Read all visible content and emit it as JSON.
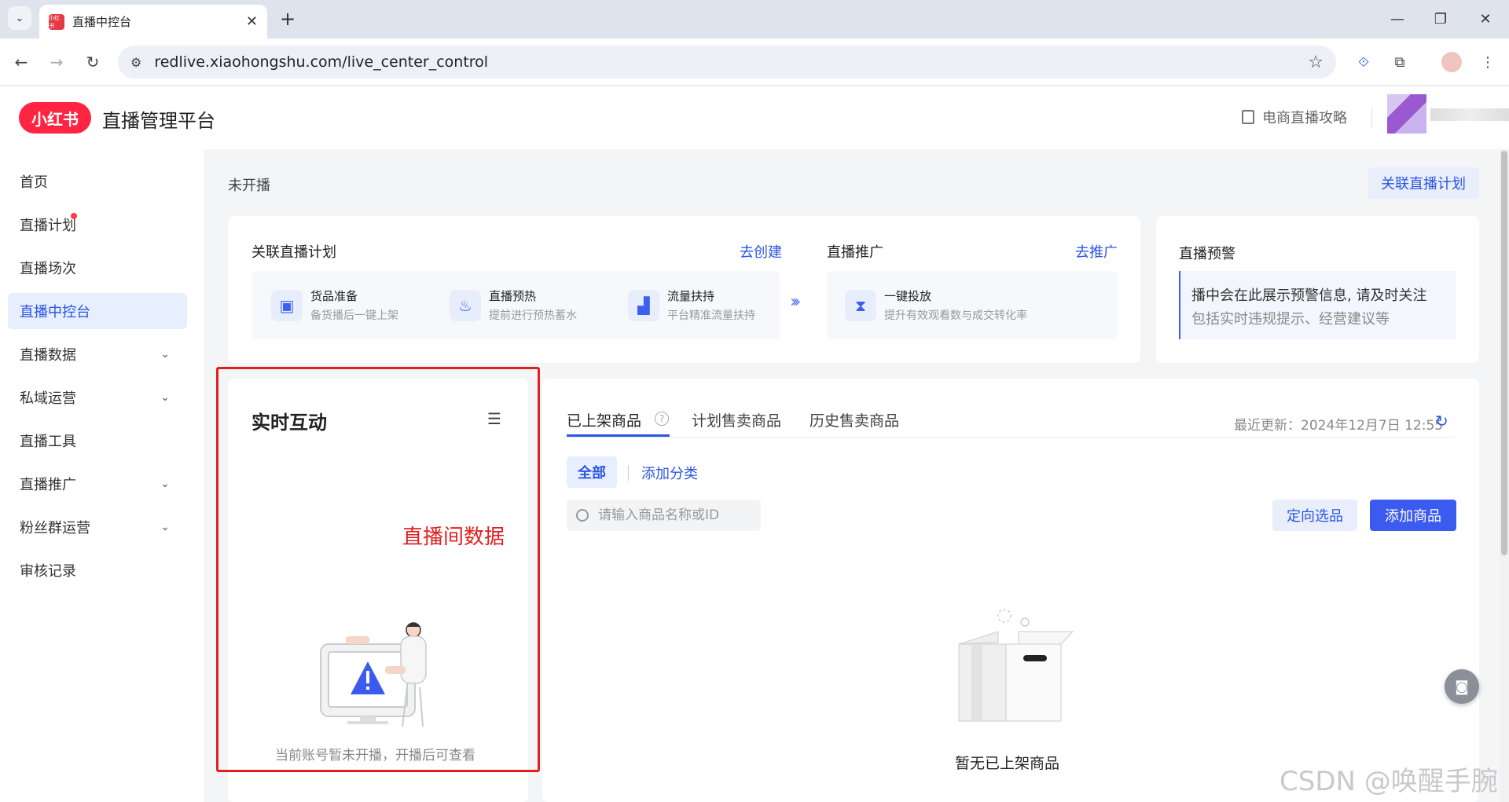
{
  "browser": {
    "tab_title": "直播中控台",
    "favicon_text": "小红书",
    "url": "redlive.xiaohongshu.com/live_center_control"
  },
  "header": {
    "logo_text": "小红书",
    "platform_name": "直播管理平台",
    "guide_link": "电商直播攻略"
  },
  "sidebar": {
    "items": [
      {
        "label": "首页"
      },
      {
        "label": "直播计划"
      },
      {
        "label": "直播场次"
      },
      {
        "label": "直播中控台"
      },
      {
        "label": "直播数据"
      },
      {
        "label": "私域运营"
      },
      {
        "label": "直播工具"
      },
      {
        "label": "直播推广"
      },
      {
        "label": "粉丝群运营"
      },
      {
        "label": "审核记录"
      }
    ],
    "active_item": "直播中控台"
  },
  "main": {
    "status": "未开播",
    "link_plan_button": "关联直播计划",
    "plan_section": {
      "title": "关联直播计划",
      "action": "去创建",
      "steps": [
        {
          "title": "货品准备",
          "desc": "备货播后一键上架",
          "icon": "bag-icon"
        },
        {
          "title": "直播预热",
          "desc": "提前进行预热蓄水",
          "icon": "fire-icon"
        },
        {
          "title": "流量扶持",
          "desc": "平台精准流量扶持",
          "icon": "trend-icon"
        }
      ]
    },
    "promo_section": {
      "title": "直播推广",
      "action": "去推广",
      "step": {
        "title": "一键投放",
        "desc": "提升有效观看数与成交转化率",
        "icon": "hourglass-icon"
      }
    },
    "warning_section": {
      "title": "直播预警",
      "line1": "播中会在此展示预警信息, 请及时关注",
      "line2": "包括实时违规提示、经营建议等"
    },
    "realtime": {
      "title": "实时互动",
      "annotation": "直播间数据",
      "empty_text": "当前账号暂未开播，开播后可查看"
    },
    "goods": {
      "tabs": [
        "已上架商品",
        "计划售卖商品",
        "历史售卖商品"
      ],
      "active_tab": "已上架商品",
      "updated": "最近更新：2024年12月7日 12:55",
      "chip_all": "全部",
      "add_category": "添加分类",
      "search_placeholder": "请输入商品名称或ID",
      "directed_select": "定向选品",
      "add_goods": "添加商品",
      "empty_text": "暂无已上架商品"
    }
  },
  "watermark": "CSDN @唤醒手腕",
  "colors": {
    "brand_red": "#ff2442",
    "accent_blue": "#2a55e5",
    "annotation_red": "#e02020"
  }
}
